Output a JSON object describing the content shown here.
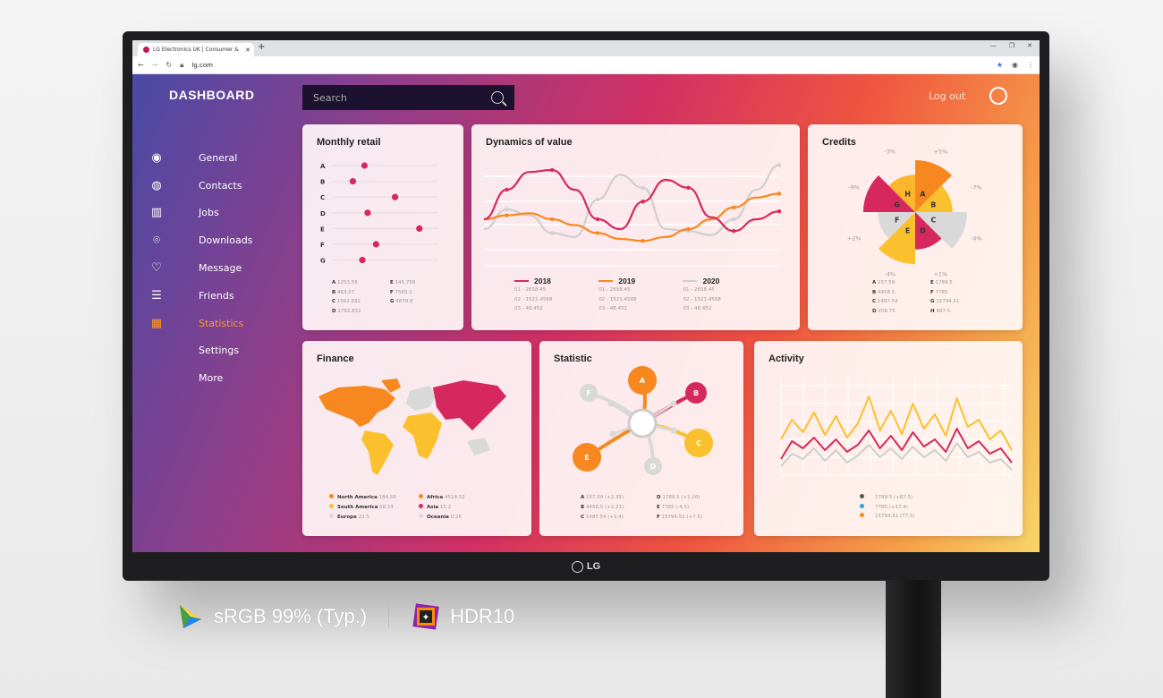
{
  "browser": {
    "tab_title": "LG Electronics UK | Consumer &",
    "url": "lg.com",
    "new_tab": "+"
  },
  "header": {
    "title": "DASHBOARD",
    "search_placeholder": "Search",
    "logout": "Log out"
  },
  "sidebar": {
    "items": [
      {
        "label": "General",
        "icon": "target-icon",
        "glyph": "◉",
        "active": false
      },
      {
        "label": "Contacts",
        "icon": "user-circle-icon",
        "glyph": "◍",
        "active": false
      },
      {
        "label": "Jobs",
        "icon": "map-icon",
        "glyph": "▥",
        "active": false
      },
      {
        "label": "Downloads",
        "icon": "location-pin-icon",
        "glyph": "⌾",
        "active": false
      },
      {
        "label": "Message",
        "icon": "heart-icon",
        "glyph": "♡",
        "active": false
      },
      {
        "label": "Friends",
        "icon": "sliders-icon",
        "glyph": "☰",
        "active": false
      },
      {
        "label": "Statistics",
        "icon": "grid-icon",
        "glyph": "▦",
        "active": true
      },
      {
        "label": "Settings",
        "icon": "",
        "glyph": "",
        "active": false
      },
      {
        "label": "More",
        "icon": "",
        "glyph": "",
        "active": false
      }
    ]
  },
  "cards": {
    "monthly_retail": {
      "title": "Monthly retail",
      "rows": [
        "A",
        "B",
        "C",
        "D",
        "E",
        "F",
        "G"
      ],
      "levels": [
        0.3,
        0.19,
        0.59,
        0.33,
        0.82,
        0.41,
        0.28
      ],
      "legend": [
        [
          "A",
          "1253.55"
        ],
        [
          "B",
          "463.57"
        ],
        [
          "C",
          "1562.832"
        ],
        [
          "D",
          "1782.831"
        ],
        [
          "E",
          "145.758"
        ],
        [
          "F",
          "7583.1"
        ],
        [
          "G",
          "4879.8"
        ]
      ]
    },
    "dynamics": {
      "title": "Dynamics of value",
      "series": [
        {
          "name": "2018",
          "color": "#d6285e",
          "points": [
            40,
            70,
            88,
            90,
            70,
            40,
            30,
            58,
            80,
            72,
            42,
            28,
            40,
            48
          ]
        },
        {
          "name": "2019",
          "color": "#f7881f",
          "points": [
            40,
            44,
            46,
            40,
            34,
            26,
            20,
            18,
            22,
            30,
            40,
            52,
            62,
            66
          ]
        },
        {
          "name": "2020",
          "color": "#cfcfcf",
          "points": [
            30,
            50,
            44,
            26,
            22,
            60,
            85,
            72,
            30,
            28,
            24,
            40,
            70,
            95
          ]
        }
      ],
      "lines": [
        "01 - 2658.45",
        "02 - 1521.4568",
        "03 - 48.452"
      ]
    },
    "credits": {
      "title": "Credits",
      "sectors": [
        {
          "label": "A",
          "pct": "+5%",
          "color": "#f7881f",
          "r": 1.0
        },
        {
          "label": "B",
          "pct": "-7%",
          "color": "#fbc02d",
          "r": 0.72
        },
        {
          "label": "C",
          "pct": "-4%",
          "color": "#d9d9d9",
          "r": 1.0
        },
        {
          "label": "D",
          "pct": "+1%",
          "color": "#d6285e",
          "r": 0.72
        },
        {
          "label": "E",
          "pct": "-4%",
          "color": "#fbc02d",
          "r": 1.0
        },
        {
          "label": "F",
          "pct": "+2%",
          "color": "#d9d9d9",
          "r": 0.72
        },
        {
          "label": "G",
          "pct": "-9%",
          "color": "#d6285e",
          "r": 1.0
        },
        {
          "label": "H",
          "pct": "-3%",
          "color": "#fbb62d",
          "r": 0.72
        }
      ],
      "legend": [
        [
          "A",
          "157.59"
        ],
        [
          "B",
          "4458.5"
        ],
        [
          "C",
          "1487.54"
        ],
        [
          "D",
          "258.75"
        ],
        [
          "E",
          "1789.5"
        ],
        [
          "F",
          "7785"
        ],
        [
          "G",
          "15794.51"
        ],
        [
          "H",
          "487.5"
        ]
      ]
    },
    "finance": {
      "title": "Finance",
      "legend": [
        {
          "name": "North America",
          "value": "184.56",
          "color": "#f7881f"
        },
        {
          "name": "South America",
          "value": "58.54",
          "color": "#fbc02d"
        },
        {
          "name": "Europe",
          "value": "22.5",
          "color": "#d9d9d9"
        },
        {
          "name": "Africa",
          "value": "4518.52",
          "color": "#f7881f"
        },
        {
          "name": "Asia",
          "value": "15.2",
          "color": "#d6285e"
        },
        {
          "name": "Oceania",
          "value": "0.26",
          "color": "#d9d9d9"
        }
      ]
    },
    "statistic": {
      "title": "Statistic",
      "petals": [
        {
          "label": "A",
          "color": "#f7881f"
        },
        {
          "label": "B",
          "color": "#d6285e"
        },
        {
          "label": "C",
          "color": "#fbc02d"
        },
        {
          "label": "D",
          "color": "#d9d9d9"
        },
        {
          "label": "E",
          "color": "#f7881f"
        },
        {
          "label": "F",
          "color": "#d9d9d9"
        }
      ],
      "legend": [
        [
          "A",
          "157.59 (+2.35)"
        ],
        [
          "B",
          "4458.5 (+2.21)"
        ],
        [
          "C",
          "1487.54 (+1.4)"
        ],
        [
          "D",
          "1789.5 (+1.26)"
        ],
        [
          "E",
          "7785 (-4.5)"
        ],
        [
          "F",
          "15794.51 (+7.5)"
        ]
      ]
    },
    "activity": {
      "title": "Activity",
      "series": [
        {
          "color": "#fbc02d",
          "points": [
            40,
            62,
            48,
            70,
            45,
            66,
            42,
            58,
            88,
            50,
            72,
            46,
            80,
            52,
            68,
            44,
            86,
            54,
            62,
            40,
            50,
            28
          ]
        },
        {
          "color": "#d6285e",
          "points": [
            18,
            38,
            30,
            42,
            28,
            40,
            26,
            34,
            50,
            30,
            44,
            28,
            48,
            32,
            40,
            26,
            52,
            30,
            38,
            24,
            30,
            14
          ]
        },
        {
          "color": "#cfcfcf",
          "points": [
            10,
            24,
            18,
            30,
            16,
            28,
            14,
            22,
            34,
            20,
            30,
            18,
            32,
            20,
            28,
            16,
            36,
            20,
            26,
            14,
            18,
            6
          ]
        }
      ],
      "legend": [
        {
          "text": "1789.5  (+87.5)",
          "color": "#555555"
        },
        {
          "text": "7785 (+17.4)",
          "color": "#2aa8e0"
        },
        {
          "text": "15794.51 (77.5)",
          "color": "#f7881f"
        }
      ]
    }
  },
  "monitor": {
    "brand": "LG"
  },
  "badges": {
    "srgb": "sRGB 99% (Typ.)",
    "hdr": "HDR10"
  }
}
